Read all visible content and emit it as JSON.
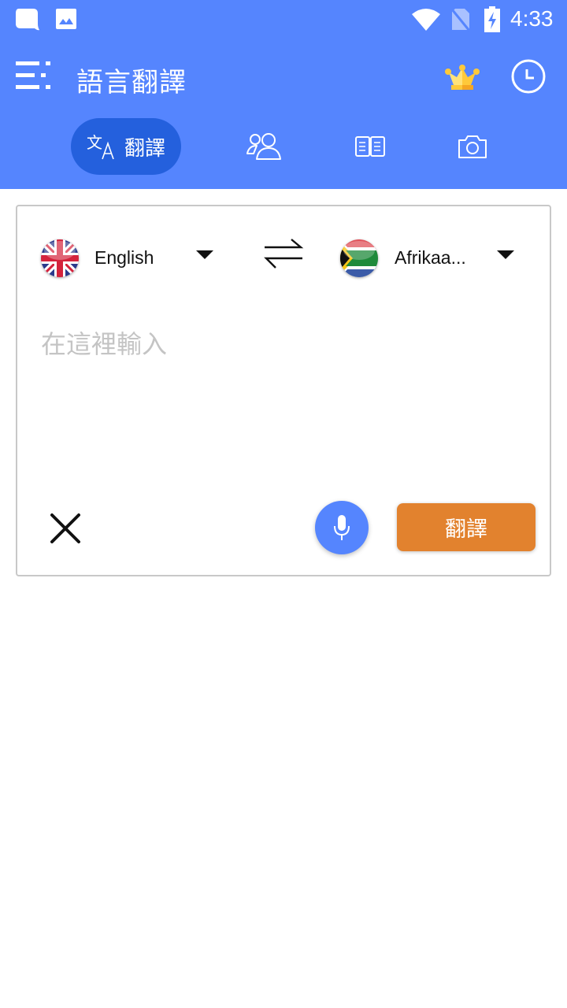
{
  "status_bar": {
    "time": "4:33",
    "icons": [
      "chat-bubble-icon",
      "image-icon",
      "wifi-icon",
      "no-sim-icon",
      "battery-charging-icon"
    ]
  },
  "toolbar": {
    "title": "語言翻譯",
    "menu_icon": "menu-icon",
    "premium_icon": "crown-icon",
    "history_icon": "clock-icon"
  },
  "tabs": [
    {
      "label": "翻譯",
      "icon": "translate-icon",
      "active": true
    },
    {
      "label": "",
      "icon": "conversation-icon",
      "active": false
    },
    {
      "label": "",
      "icon": "dictionary-book-icon",
      "active": false
    },
    {
      "label": "",
      "icon": "camera-icon",
      "active": false
    }
  ],
  "translator": {
    "source_language": "English",
    "target_language": "Afrikaa...",
    "source_flag": "uk-flag",
    "target_flag": "south-africa-flag",
    "input_value": "",
    "input_placeholder": "在這裡輸入",
    "translate_button": "翻譯"
  },
  "colors": {
    "primary": "#5585fe",
    "active_tab": "#2460dd",
    "translate_button": "#e2822e",
    "placeholder": "#c4c4c4"
  }
}
